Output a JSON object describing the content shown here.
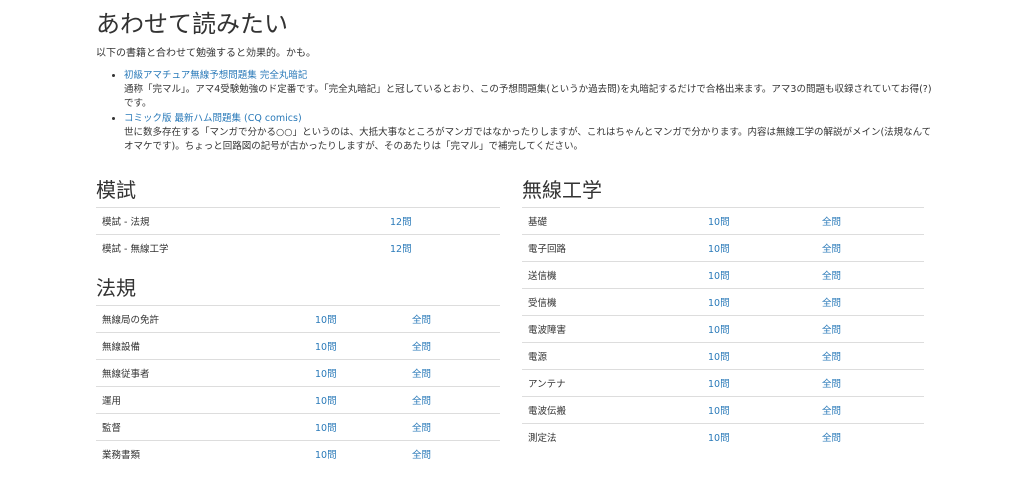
{
  "intro": {
    "title": "あわせて読みたい",
    "lead": "以下の書籍と合わせて勉強すると効果的。かも。",
    "books": [
      {
        "title": "初級アマチュア無線予想問題集 完全丸暗記",
        "desc": "通称「完マル」。アマ4受験勉強のド定番です。「完全丸暗記」と冠しているとおり、この予想問題集(というか過去問)を丸暗記するだけで合格出来ます。アマ3の問題も収録されていてお得(?)です。"
      },
      {
        "title": "コミック版 最新ハム問題集 (CQ comics)",
        "desc": "世に数多存在する「マンガで分かる○○」というのは、大抵大事なところがマンガではなかったりしますが、これはちゃんとマンガで分かります。内容は無線工学の解説がメイン(法規なんてオマケです)。ちょっと回路図の記号が古かったりしますが、そのあたりは「完マル」で補完してください。"
      }
    ]
  },
  "mock": {
    "heading": "模試",
    "rows": [
      {
        "name": "模試 - 法規",
        "ten": "12問"
      },
      {
        "name": "模試 - 無線工学",
        "ten": "12問"
      }
    ]
  },
  "law": {
    "heading": "法規",
    "rows": [
      {
        "name": "無線局の免許",
        "ten": "10問",
        "all": "全問"
      },
      {
        "name": "無線設備",
        "ten": "10問",
        "all": "全問"
      },
      {
        "name": "無線従事者",
        "ten": "10問",
        "all": "全問"
      },
      {
        "name": "運用",
        "ten": "10問",
        "all": "全問"
      },
      {
        "name": "監督",
        "ten": "10問",
        "all": "全問"
      },
      {
        "name": "業務書類",
        "ten": "10問",
        "all": "全問"
      }
    ]
  },
  "eng": {
    "heading": "無線工学",
    "rows": [
      {
        "name": "基礎",
        "ten": "10問",
        "all": "全問"
      },
      {
        "name": "電子回路",
        "ten": "10問",
        "all": "全問"
      },
      {
        "name": "送信機",
        "ten": "10問",
        "all": "全問"
      },
      {
        "name": "受信機",
        "ten": "10問",
        "all": "全問"
      },
      {
        "name": "電波障害",
        "ten": "10問",
        "all": "全問"
      },
      {
        "name": "電源",
        "ten": "10問",
        "all": "全問"
      },
      {
        "name": "アンテナ",
        "ten": "10問",
        "all": "全問"
      },
      {
        "name": "電波伝搬",
        "ten": "10問",
        "all": "全問"
      },
      {
        "name": "測定法",
        "ten": "10問",
        "all": "全問"
      }
    ]
  },
  "colors": {
    "link": "#2a7ab9",
    "text": "#333333",
    "rule": "#dddddd"
  }
}
